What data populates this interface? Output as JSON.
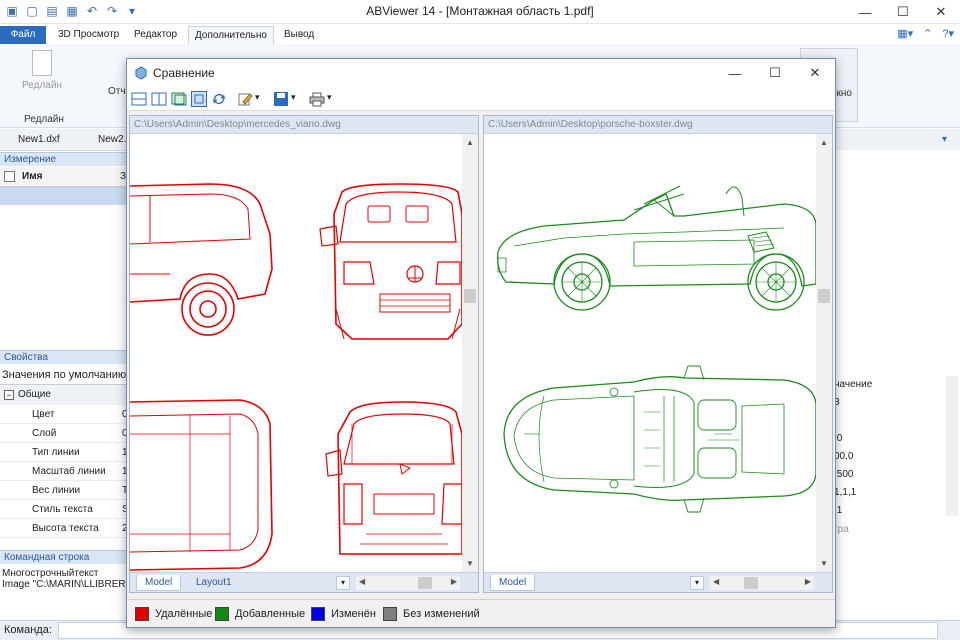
{
  "app": {
    "title": "ABViewer 14 - [Монтажная область 1.pdf]"
  },
  "menu": {
    "file": "Файл",
    "items": [
      "3D Просмотр",
      "Редактор",
      "Дополнительно",
      "Вывод"
    ]
  },
  "ribbon": {
    "button_label": "Редлайн",
    "group_label": "Редлайн",
    "cut_text_left": "Отч",
    "cut_text_right": "Окно"
  },
  "doc_tabs": [
    "New1.dxf",
    "New2."
  ],
  "measure_panel": {
    "title": "Измерение",
    "col_name": "Имя",
    "col_cut": "З"
  },
  "properties_panel": {
    "title": "Свойства",
    "defaults": "Значения по умолчанию",
    "group": "Общие",
    "rows": [
      "Цвет",
      "Слой",
      "Тип линии",
      "Масштаб линии",
      "Вес линии",
      "Стиль текста",
      "Высота текста"
    ],
    "row_cut_values": [
      "0",
      "0",
      "1",
      "1",
      "Т",
      "S",
      "2"
    ]
  },
  "right_partial": {
    "header": "начение",
    "values": [
      "3",
      "0",
      ",0",
      "00,0",
      ",500",
      "1,1,1",
      ",1"
    ],
    "bottom": "гра"
  },
  "command_panel": {
    "title": "Командная строка",
    "line1": "Многострочныйтекст",
    "line2": "Image \"C:\\MARIN\\LLIBRER",
    "prompt": "Команда:"
  },
  "dialog": {
    "title": "Сравнение",
    "left_path": "C:\\Users\\Admin\\Desktop\\mercedes_viano.dwg",
    "right_path": "C:\\Users\\Admin\\Desktop\\porsche-boxster.dwg",
    "left_tabs": [
      "Model",
      "Layout1"
    ],
    "right_tabs": [
      "Model"
    ],
    "legend": [
      {
        "label": "Удалённые",
        "color": "#e00000"
      },
      {
        "label": "Добавленные",
        "color": "#108a10"
      },
      {
        "label": "Изменён",
        "color": "#0000e0"
      },
      {
        "label": "Без изменений",
        "color": "#808080"
      }
    ]
  },
  "colors": {
    "removed_lines": "#e60000",
    "added_lines": "#1a8c1a",
    "accent": "#2a6bc0"
  }
}
